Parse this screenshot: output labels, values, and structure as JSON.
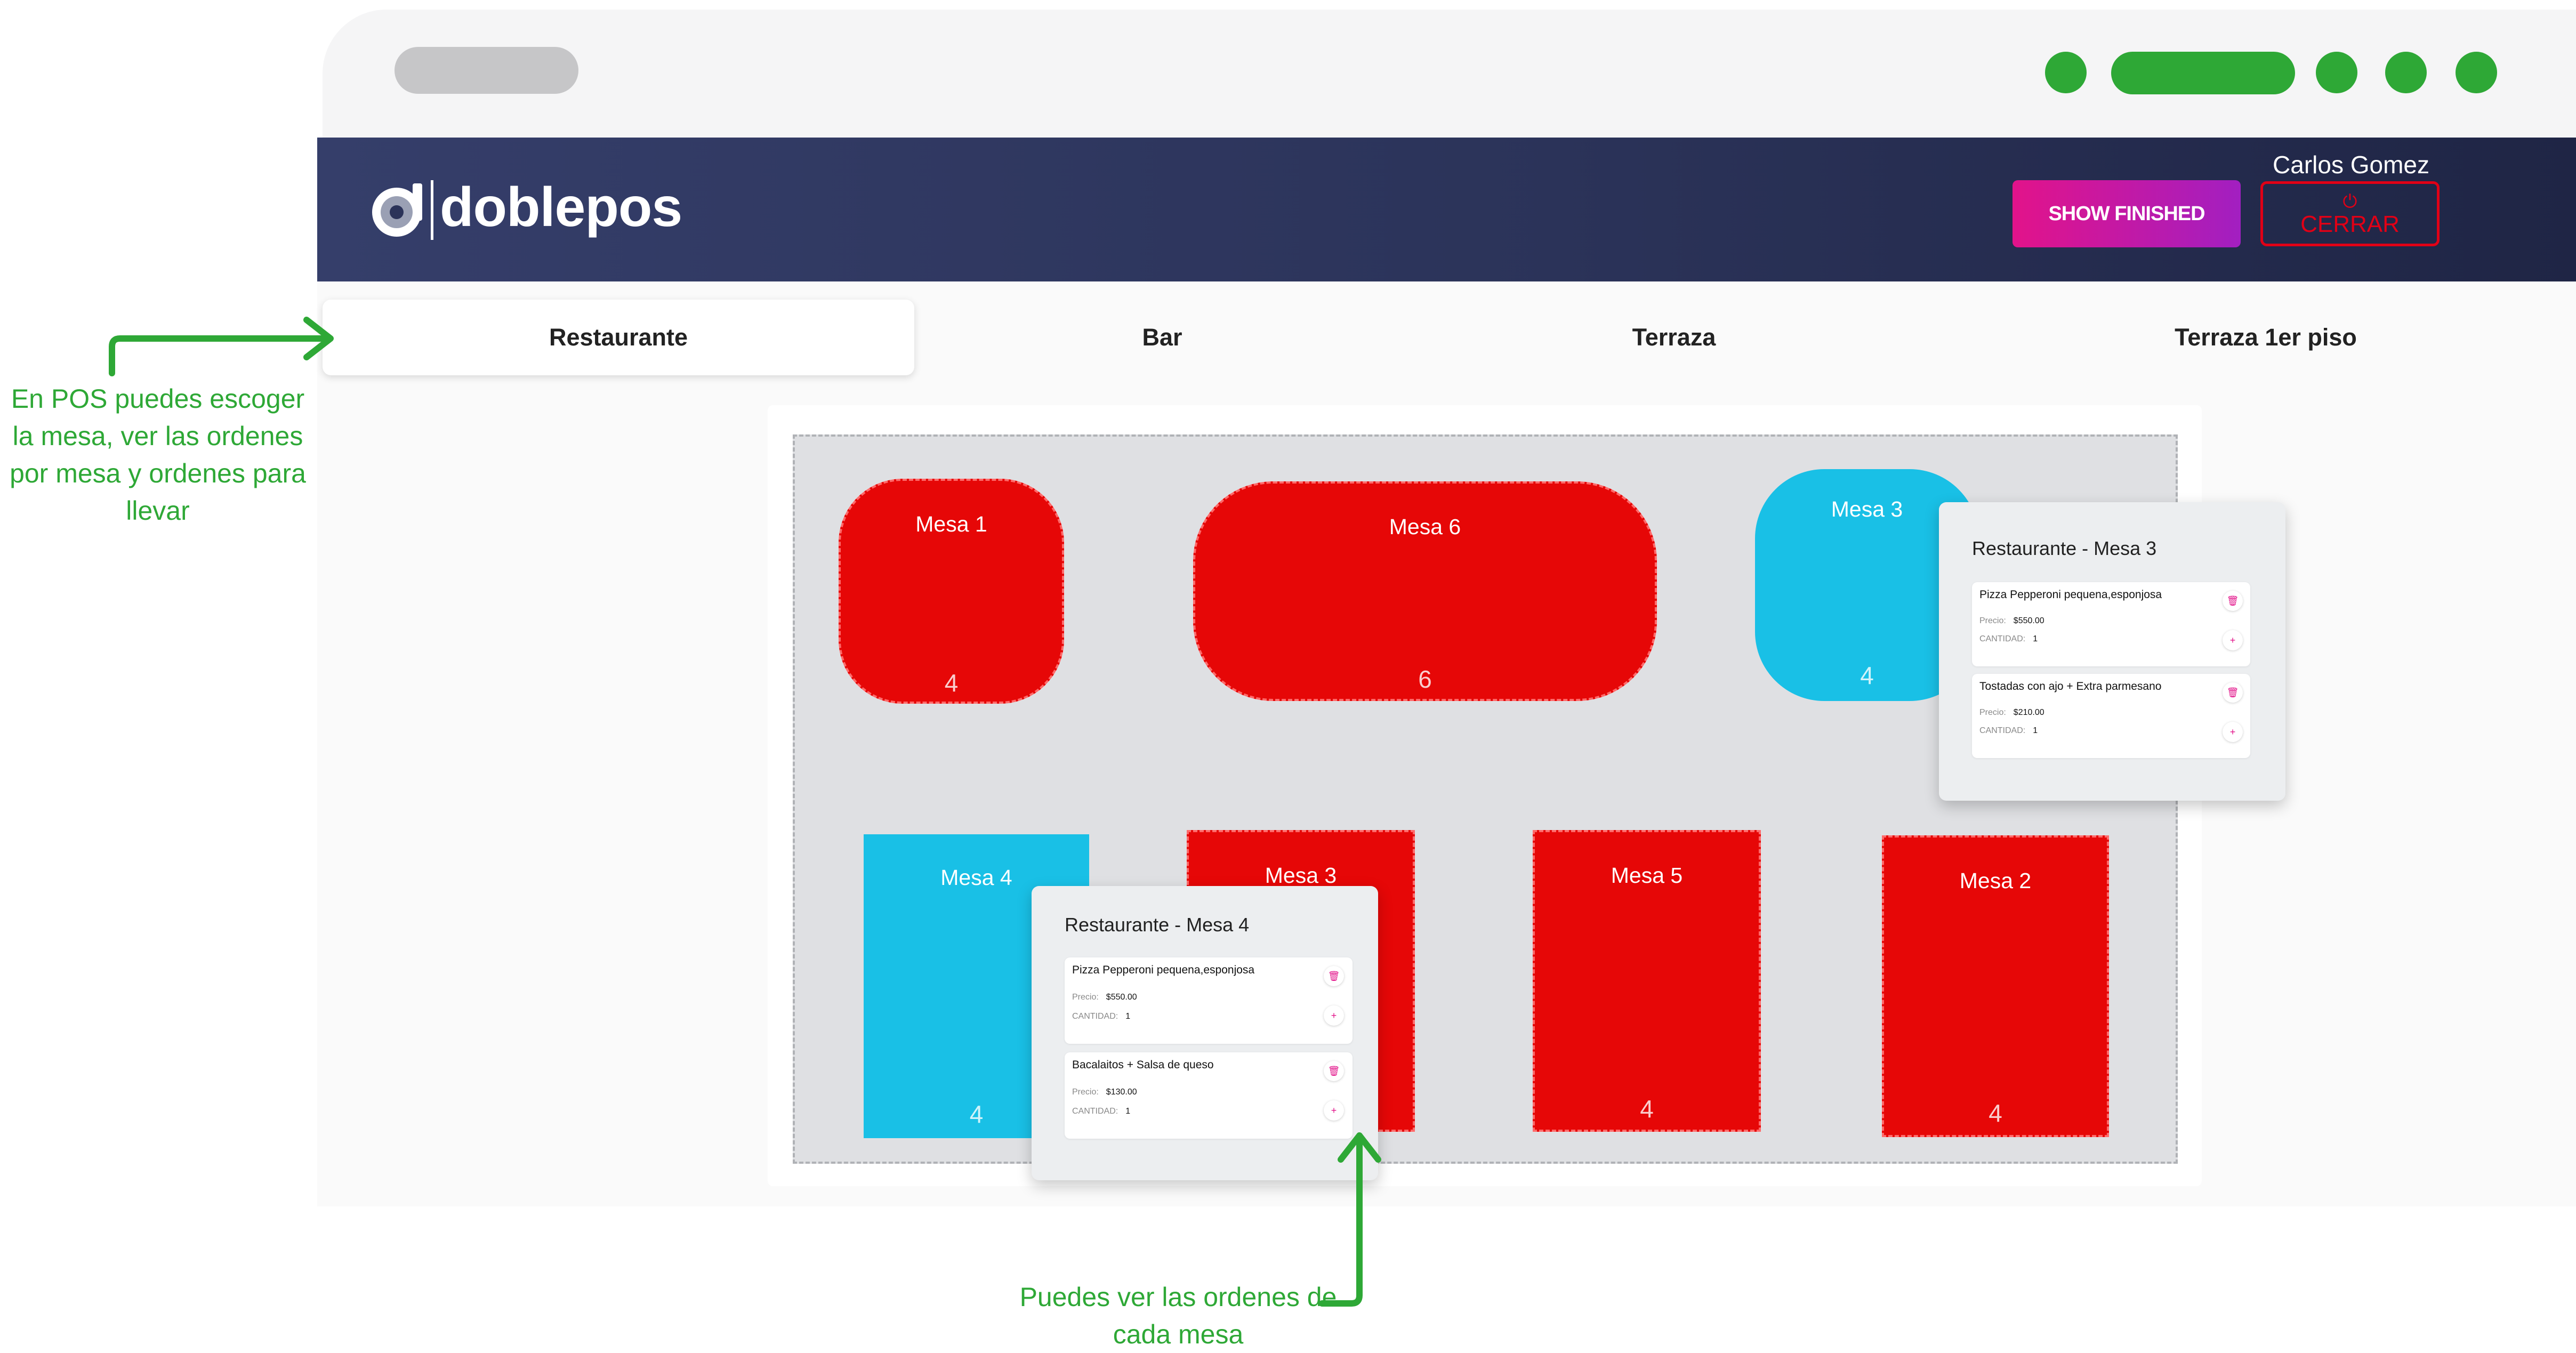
{
  "header": {
    "logo_text": "doblepos",
    "user_name": "Carlos Gomez",
    "show_finished_label": "SHOW FINISHED",
    "logout_label": "CERRAR",
    "logout_icon": "power-icon"
  },
  "tabs": [
    "Restaurante",
    "Bar",
    "Terraza",
    "Terraza 1er piso"
  ],
  "active_tab": "Restaurante",
  "tables": [
    {
      "name": "Mesa 1",
      "seats": "4",
      "status": "occupied",
      "color": "#e60707"
    },
    {
      "name": "Mesa 6",
      "seats": "6",
      "status": "occupied",
      "color": "#e60707"
    },
    {
      "name": "Mesa 3",
      "seats": "4",
      "status": "selected",
      "color": "#19c0e6"
    },
    {
      "name": "Mesa 4",
      "seats": "4",
      "status": "selected",
      "color": "#19c0e6"
    },
    {
      "name": "Mesa 3",
      "seats": "",
      "status": "occupied",
      "color": "#e60707"
    },
    {
      "name": "Mesa 5",
      "seats": "4",
      "status": "occupied",
      "color": "#e60707"
    },
    {
      "name": "Mesa 2",
      "seats": "4",
      "status": "occupied",
      "color": "#e60707"
    }
  ],
  "popups": [
    {
      "title": "Restaurante - Mesa 3",
      "items": [
        {
          "name": "Pizza Pepperoni pequena,esponjosa",
          "price_label": "Precio:",
          "price": "$550.00",
          "qty_label": "CANTIDAD:",
          "qty": "1"
        },
        {
          "name": "Tostadas con ajo + Extra parmesano",
          "price_label": "Precio:",
          "price": "$210.00",
          "qty_label": "CANTIDAD:",
          "qty": "1"
        }
      ]
    },
    {
      "title": "Restaurante - Mesa 4",
      "items": [
        {
          "name": "Pizza Pepperoni pequena,esponjosa",
          "price_label": "Precio:",
          "price": "$550.00",
          "qty_label": "CANTIDAD:",
          "qty": "1"
        },
        {
          "name": "Bacalaitos + Salsa de queso",
          "price_label": "Precio:",
          "price": "$130.00",
          "qty_label": "CANTIDAD:",
          "qty": "1"
        }
      ]
    }
  ],
  "annotations": {
    "left": "En POS puedes escoger la mesa, ver las ordenes por mesa y ordenes para llevar",
    "bottom": "Puedes ver las ordenes de cada mesa"
  },
  "colors": {
    "accent_green": "#2ea836",
    "header_navy": "#2b3359",
    "table_occupied": "#e60707",
    "table_selected": "#19c0e6",
    "button_gradient_start": "#e2138a",
    "button_gradient_end": "#a21fc1"
  }
}
